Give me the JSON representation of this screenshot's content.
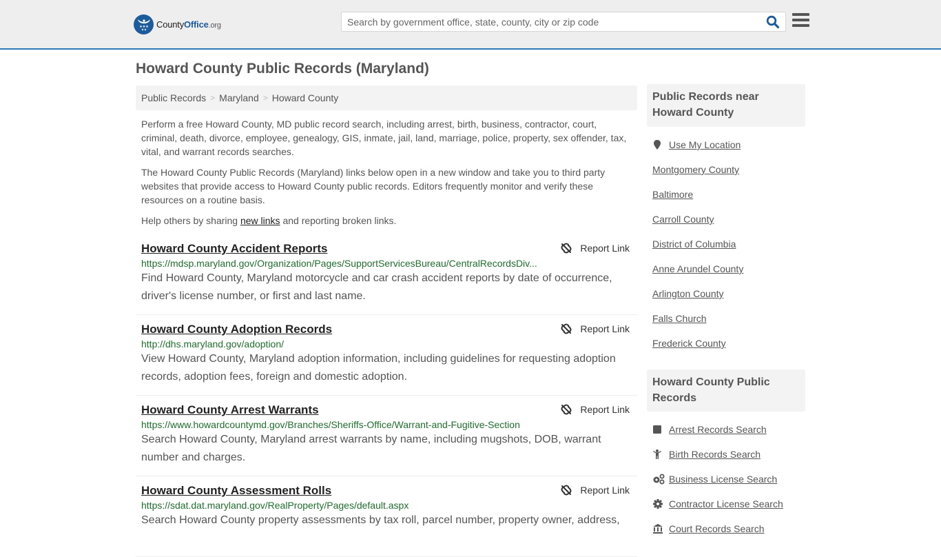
{
  "header": {
    "logo": {
      "county": "County",
      "office": "Office",
      "tld": ".org"
    },
    "search": {
      "placeholder": "Search by government office, state, county, city or zip code",
      "value": ""
    },
    "colors": {
      "brand": "#1d5c9c",
      "accent_line": "#2e7ab8"
    }
  },
  "page": {
    "title": "Howard County Public Records (Maryland)",
    "breadcrumb": [
      "Public Records",
      "Maryland",
      "Howard County"
    ],
    "intro": {
      "p1": "Perform a free Howard County, MD public record search, including arrest, birth, business, contractor, court, criminal, death, divorce, employee, genealogy, GIS, inmate, jail, land, marriage, police, property, sex offender, tax, vital, and warrant records searches.",
      "p2": "The Howard County Public Records (Maryland) links below open in a new window and take you to third party websites that provide access to Howard County public records. Editors frequently monitor and verify these resources on a routine basis.",
      "p3_before": "Help others by sharing ",
      "p3_link": "new links",
      "p3_after": " and reporting broken links."
    }
  },
  "records": [
    {
      "title": "Howard County Accident Reports",
      "url": "https://mdsp.maryland.gov/Organization/Pages/SupportServicesBureau/CentralRecordsDiv...",
      "description": "Find Howard County, Maryland motorcycle and car crash accident reports by date of occurrence, driver's license number, or first and last name.",
      "report_label": "Report Link"
    },
    {
      "title": "Howard County Adoption Records",
      "url": "http://dhs.maryland.gov/adoption/",
      "description": "View Howard County, Maryland adoption information, including guidelines for requesting adoption records, adoption fees, foreign and domestic adoption.",
      "report_label": "Report Link"
    },
    {
      "title": "Howard County Arrest Warrants",
      "url": "https://www.howardcountymd.gov/Branches/Sheriffs-Office/Warrant-and-Fugitive-Section",
      "description": "Search Howard County, Maryland arrest warrants by name, including mugshots, DOB, warrant number and charges.",
      "report_label": "Report Link"
    },
    {
      "title": "Howard County Assessment Rolls",
      "url": "https://sdat.dat.maryland.gov/RealProperty/Pages/default.aspx",
      "description": "Search Howard County property assessments by tax roll, parcel number, property owner, address,",
      "report_label": "Report Link"
    }
  ],
  "sidebar": {
    "nearby": {
      "heading": "Public Records near Howard County",
      "use_location": {
        "label": "Use My Location",
        "icon": "map-pin-icon"
      },
      "items": [
        "Montgomery County",
        "Baltimore",
        "Carroll County",
        "District of Columbia",
        "Anne Arundel County",
        "Arlington County",
        "Falls Church",
        "Frederick County"
      ]
    },
    "county_records": {
      "heading": "Howard County Public Records",
      "items": [
        {
          "label": "Arrest Records Search",
          "icon": "book-icon"
        },
        {
          "label": "Birth Records Search",
          "icon": "child-icon"
        },
        {
          "label": "Business License Search",
          "icon": "cogs-icon"
        },
        {
          "label": "Contractor License Search",
          "icon": "gear-icon"
        },
        {
          "label": "Court Records Search",
          "icon": "courthouse-icon"
        }
      ]
    }
  }
}
